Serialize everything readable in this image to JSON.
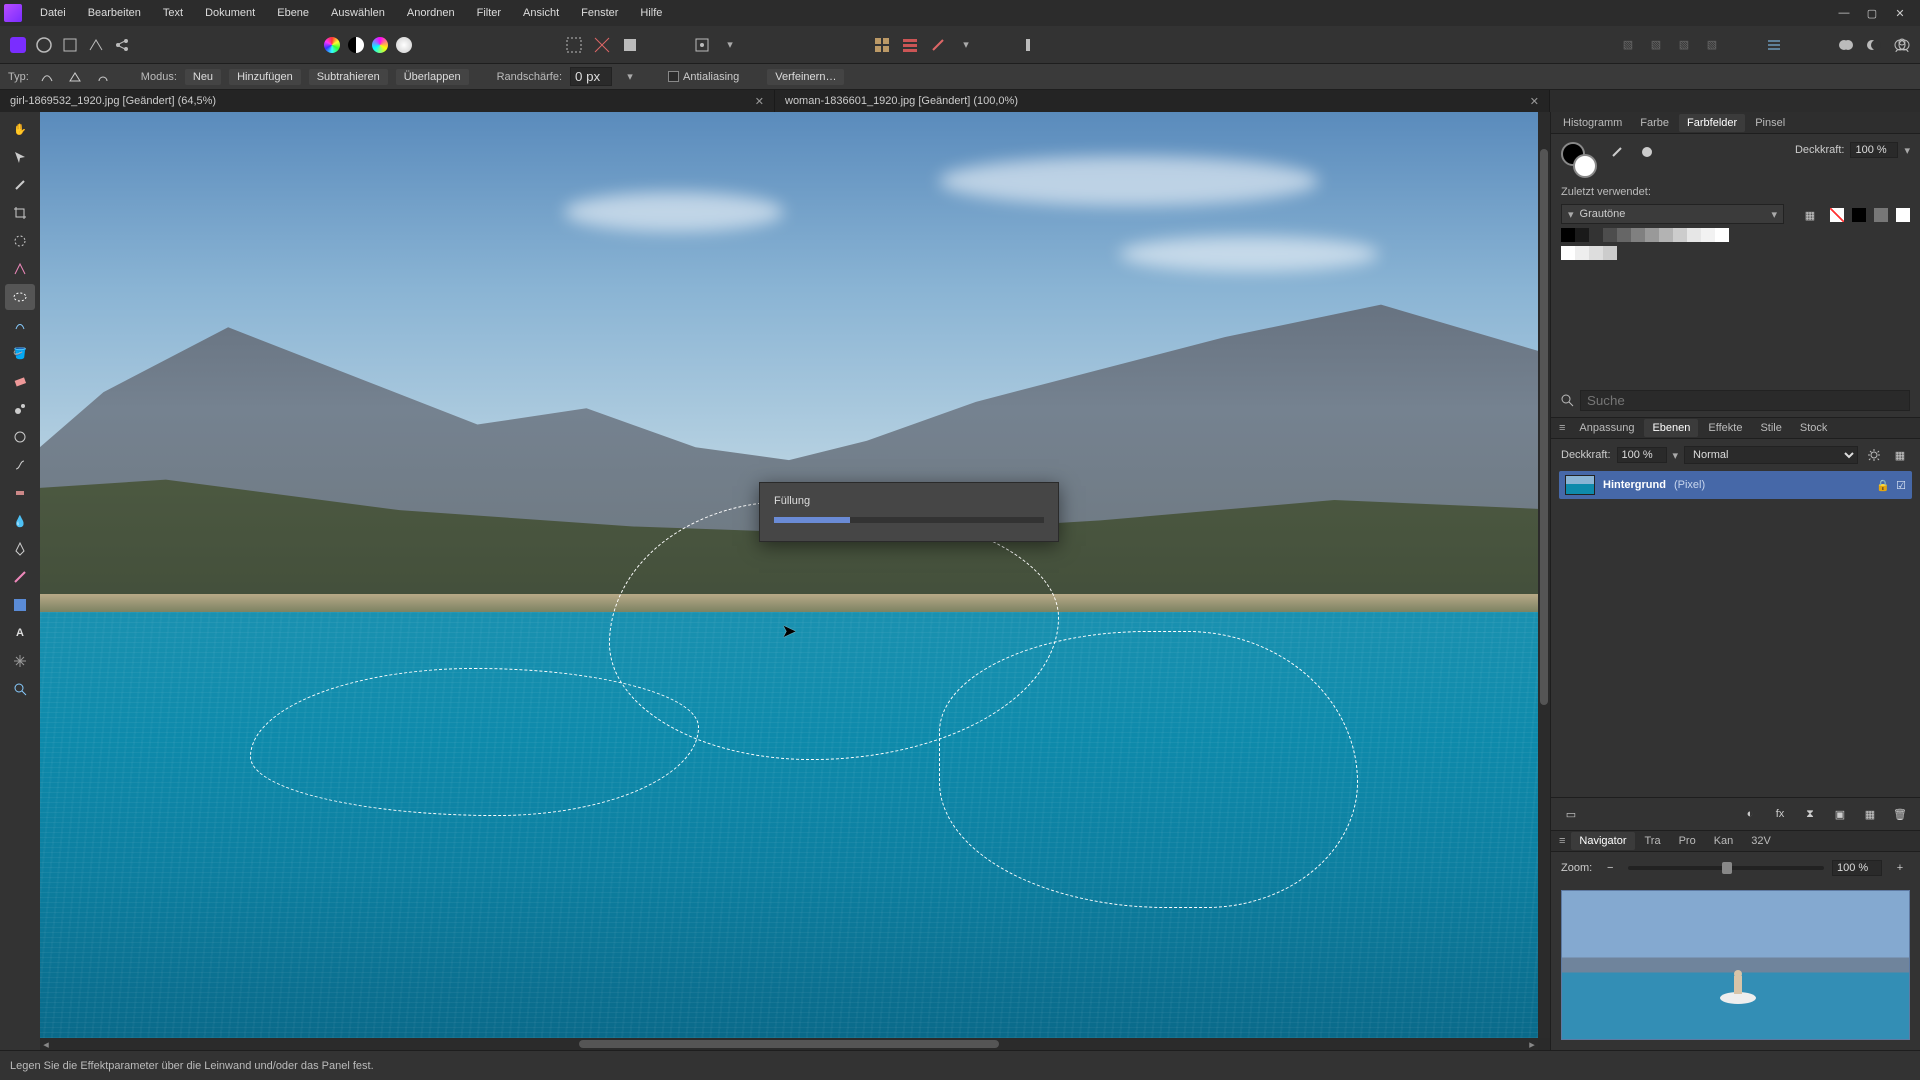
{
  "menu": [
    "Datei",
    "Bearbeiten",
    "Text",
    "Dokument",
    "Ebene",
    "Auswählen",
    "Anordnen",
    "Filter",
    "Ansicht",
    "Fenster",
    "Hilfe"
  ],
  "options": {
    "typ_label": "Typ:",
    "modus_label": "Modus:",
    "modes": [
      "Neu",
      "Hinzufügen",
      "Subtrahieren",
      "Überlappen"
    ],
    "feather_label": "Randschärfe:",
    "feather_value": "0 px",
    "antialias_label": "Antialiasing",
    "refine_label": "Verfeinern…"
  },
  "tabs": [
    {
      "title": "girl-1869532_1920.jpg [Geändert] (64,5%)"
    },
    {
      "title": "woman-1836601_1920.jpg [Geändert] (100,0%)"
    }
  ],
  "progress": {
    "title": "Füllung"
  },
  "right": {
    "top_tabs": [
      "Histogramm",
      "Farbe",
      "Farbfelder",
      "Pinsel"
    ],
    "active_top_tab": "Farbfelder",
    "opacity_label": "Deckkraft:",
    "opacity_value": "100 %",
    "recent_label": "Zuletzt verwendet:",
    "palette_name": "Grautöne",
    "search_label": "Suche",
    "layer_tabs": [
      "Anpassung",
      "Ebenen",
      "Effekte",
      "Stile",
      "Stock"
    ],
    "active_layer_tab": "Ebenen",
    "layer_opacity_label": "Deckkraft:",
    "layer_opacity_value": "100 %",
    "blend_mode": "Normal",
    "layer_name": "Hintergrund",
    "layer_kind": "(Pixel)",
    "nav_tabs": [
      "Navigator",
      "Tra",
      "Pro",
      "Kan",
      "32V"
    ],
    "zoom_label": "Zoom:",
    "zoom_value": "100 %"
  },
  "status": "Legen Sie die Effektparameter über die Leinwand und/oder das Panel fest.",
  "colors": {
    "accent": "#4668a8"
  }
}
